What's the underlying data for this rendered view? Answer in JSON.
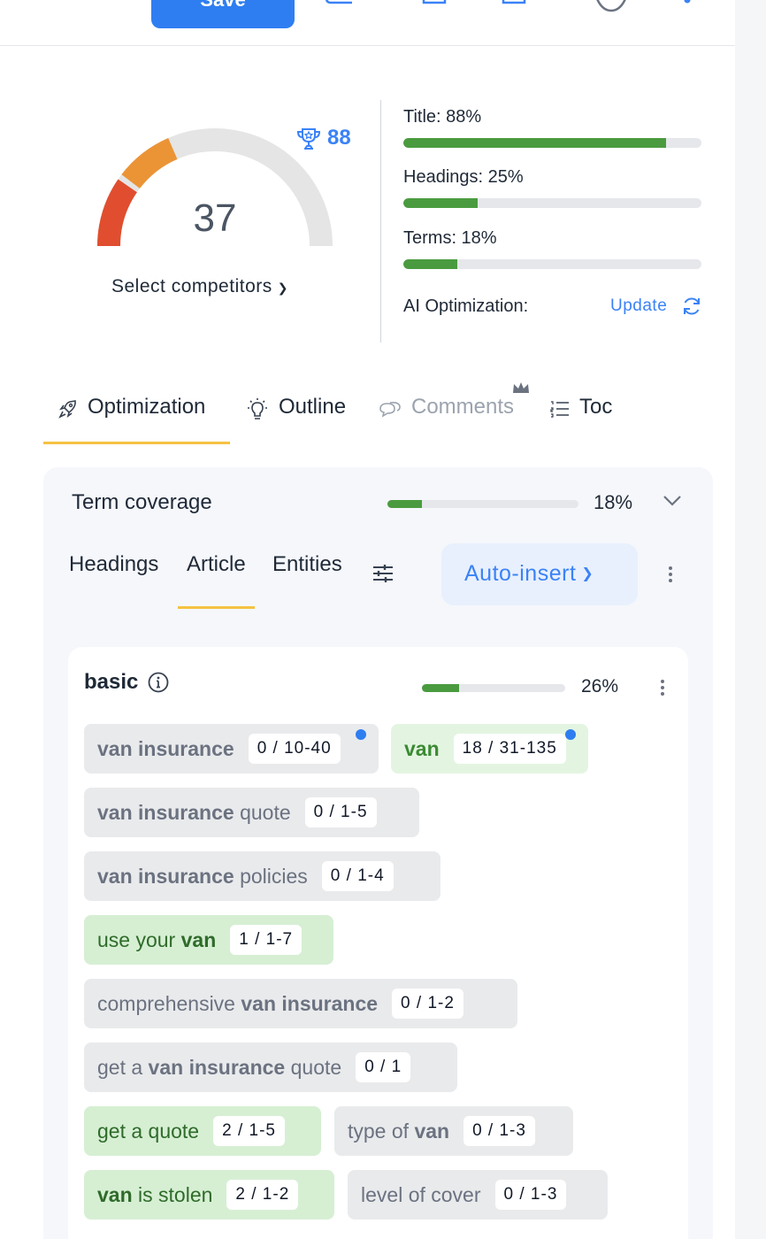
{
  "toolbar": {
    "save_label": "Save"
  },
  "score": {
    "value": "37",
    "competitor_score": "88",
    "select_competitors": "Select competitors",
    "gauge_fraction": 0.37
  },
  "metrics": [
    {
      "label": "Title: 88%",
      "percent": 88
    },
    {
      "label": "Headings: 25%",
      "percent": 25
    },
    {
      "label": "Terms: 18%",
      "percent": 18
    }
  ],
  "ai": {
    "label": "AI Optimization:",
    "update": "Update"
  },
  "tabs": {
    "optimization": "Optimization",
    "outline": "Outline",
    "comments": "Comments",
    "toc": "Toc"
  },
  "term_coverage": {
    "title": "Term coverage",
    "percent_label": "18%",
    "percent": 18
  },
  "subtabs": {
    "headings": "Headings",
    "article": "Article",
    "entities": "Entities",
    "autoinsert": "Auto-insert"
  },
  "basic": {
    "title": "basic",
    "percent_label": "26%",
    "percent": 26
  },
  "terms": [
    {
      "pre": "",
      "bold": "van insurance",
      "post": "",
      "count": "0  /  10-40",
      "state": "gray",
      "dot": true
    },
    {
      "pre": "",
      "bold": "van",
      "post": "",
      "count": "18  /  31-135",
      "state": "lightgreen",
      "dot": true
    },
    {
      "pre": "",
      "bold": "van insurance",
      "post": " quote",
      "count": "0  /  1-5",
      "state": "gray",
      "dot": false
    },
    {
      "pre": "",
      "bold": "van insurance",
      "post": " policies",
      "count": "0  /  1-4",
      "state": "gray",
      "dot": false
    },
    {
      "pre": "use your ",
      "bold": "van",
      "post": "",
      "count": "1  /  1-7",
      "state": "green",
      "dot": false
    },
    {
      "pre": "comprehensive ",
      "bold": "van insurance",
      "post": "",
      "count": "0  /  1-2",
      "state": "gray",
      "dot": false
    },
    {
      "pre": "get a ",
      "bold": "van insurance",
      "post": " quote",
      "count": "0  /  1",
      "state": "gray",
      "dot": false
    },
    {
      "pre": "get a quote",
      "bold": "",
      "post": "",
      "count": "2  /  1-5",
      "state": "green",
      "dot": false
    },
    {
      "pre": "type of ",
      "bold": "van",
      "post": "",
      "count": "0  /  1-3",
      "state": "gray",
      "dot": false
    },
    {
      "pre": "",
      "bold": "van",
      "post": " is stolen",
      "count": "2  /  1-2",
      "state": "green",
      "dot": false
    },
    {
      "pre": "level of cover",
      "bold": "",
      "post": "",
      "count": "0  /  1-3",
      "state": "gray",
      "dot": false
    }
  ],
  "colors": {
    "accent": "#2f7ef1",
    "green": "#4a9b3f",
    "tab_underline": "#f5c242",
    "gauge_red": "#e04e2f",
    "gauge_orange": "#eb9436",
    "gauge_track": "#e5e5e5"
  }
}
